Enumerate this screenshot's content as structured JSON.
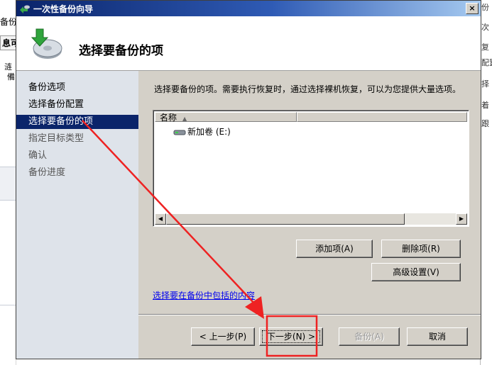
{
  "background": {
    "left_fragments": [
      "备份",
      "息可",
      "涟",
      "備"
    ],
    "right_fragments": [
      "份",
      "次",
      "复",
      "配置",
      "择",
      "着",
      "跟"
    ]
  },
  "window": {
    "title": "一次性备份向导",
    "close_label": "×"
  },
  "header": {
    "title": "选择要备份的项"
  },
  "sidebar": {
    "items": [
      {
        "label": "备份选项",
        "state": "done"
      },
      {
        "label": "选择备份配置",
        "state": "done"
      },
      {
        "label": "选择要备份的项",
        "state": "current"
      },
      {
        "label": "指定目标类型",
        "state": "pending"
      },
      {
        "label": "确认",
        "state": "pending"
      },
      {
        "label": "备份进度",
        "state": "pending"
      }
    ]
  },
  "main": {
    "description": "选择要备份的项。需要执行恢复时，通过选择裸机恢复，可以为您提供大量选项。",
    "list": {
      "column_header": "名称",
      "items": [
        "新加卷 (E:)"
      ]
    },
    "buttons": {
      "add_item": "添加项(A)",
      "remove_item": "删除项(R)",
      "advanced": "高级设置(V)"
    },
    "link": "选择要在备份中包括的内容"
  },
  "footer": {
    "back": "< 上一步(P)",
    "next": "下一步(N) >",
    "backup": "备份(A)",
    "cancel": "取消"
  },
  "colors": {
    "annotation": "#ee2222",
    "selection": "#0a246a",
    "link": "#0000ee"
  }
}
